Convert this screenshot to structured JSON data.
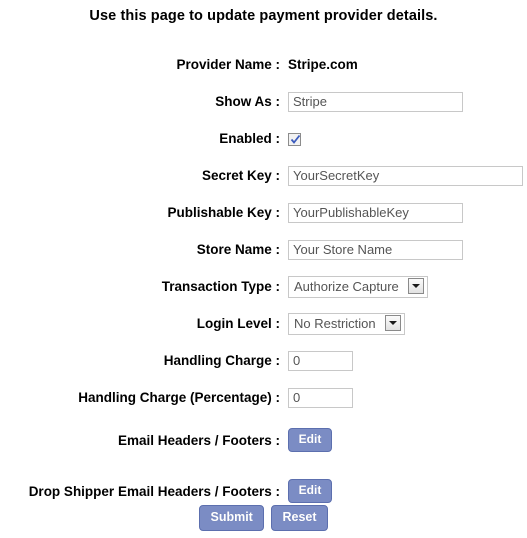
{
  "page": {
    "title": "Use this page to update payment provider details."
  },
  "form": {
    "rows": [
      {
        "label": "Provider Name :",
        "type": "static",
        "value": "Stripe.com",
        "name": "provider-name"
      },
      {
        "label": "Show As :",
        "type": "text",
        "value": "Stripe",
        "name": "show-as"
      },
      {
        "label": "Enabled :",
        "type": "checkbox",
        "checked": true,
        "name": "enabled"
      },
      {
        "label": "Secret Key :",
        "type": "text",
        "value": "YourSecretKey",
        "name": "secret-key"
      },
      {
        "label": "Publishable Key :",
        "type": "text",
        "value": "YourPublishableKey",
        "name": "publishable-key"
      },
      {
        "label": "Store Name :",
        "type": "text",
        "value": "Your Store Name",
        "name": "store-name"
      },
      {
        "label": "Transaction Type :",
        "type": "select",
        "value": "Authorize Capture",
        "name": "transaction-type"
      },
      {
        "label": "Login Level :",
        "type": "select",
        "value": "No Restriction",
        "name": "login-level"
      },
      {
        "label": "Handling Charge :",
        "type": "text",
        "value": "0",
        "name": "handling-charge"
      },
      {
        "label": "Handling Charge (Percentage) :",
        "type": "text",
        "value": "0",
        "name": "handling-charge-percentage"
      },
      {
        "label": "Email Headers / Footers :",
        "type": "button",
        "value": "Edit",
        "name": "email-headers-footers"
      },
      {
        "label": "Drop Shipper Email Headers / Footers :",
        "type": "button",
        "value": "Edit",
        "name": "drop-shipper-email-headers-footers"
      }
    ]
  },
  "footer": {
    "submit_label": "Submit",
    "reset_label": "Reset"
  },
  "colors": {
    "button_fill": "#7b8cc4",
    "button_border": "#5c6fae",
    "input_border": "#c8c8c8",
    "input_text": "#555555",
    "checkbox_check": "#3b5bbd",
    "page_background": "#ffffff",
    "text": "#000000"
  },
  "icons": {
    "checkbox_checked": "check-icon",
    "select_arrow": "chevron-down-icon"
  }
}
